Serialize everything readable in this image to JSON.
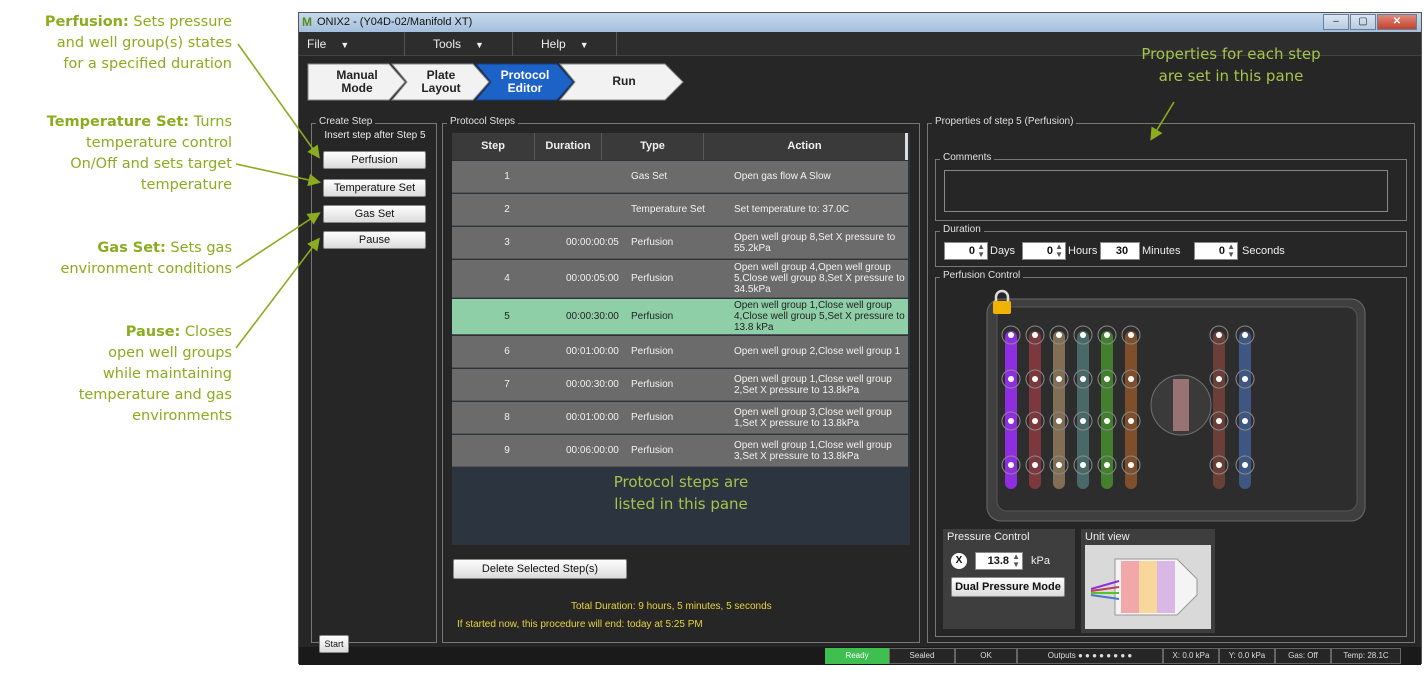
{
  "annotations": {
    "perfusion_title": "Perfusion:",
    "perfusion_l1": " Sets pressure",
    "perfusion_l2": "and well group(s) states",
    "perfusion_l3": "for a specified duration",
    "temp_title": "Temperature Set:",
    "temp_l1": " Turns",
    "temp_l2": "temperature control",
    "temp_l3": "On/Off and sets target",
    "temp_l4": "temperature",
    "gas_title": "Gas Set:",
    "gas_l1": " Sets gas",
    "gas_l2": "environment conditions",
    "pause_title": "Pause:",
    "pause_l1": " Closes",
    "pause_l2": "open well groups",
    "pause_l3": "while maintaining",
    "pause_l4": "temperature and gas",
    "pause_l5": "environments",
    "properties_l1": "Properties for each step",
    "properties_l2": "are set in this pane",
    "steps_l1": "Protocol steps are",
    "steps_l2": "listed in this pane"
  },
  "window": {
    "logo": "M",
    "title": "ONIX2 - (Y04D-02/Manifold XT)",
    "minimize": "–",
    "maximize": "▢",
    "close": "✕"
  },
  "menu": {
    "file": "File",
    "tools": "Tools",
    "help": "Help"
  },
  "breadcrumb": [
    {
      "l1": "Manual",
      "l2": "Mode"
    },
    {
      "l1": "Plate",
      "l2": "Layout"
    },
    {
      "l1": "Protocol",
      "l2": "Editor"
    },
    {
      "l1": "Run",
      "l2": ""
    }
  ],
  "create_step": {
    "label": "Create Step",
    "insert_hint": "Insert step after Step 5",
    "buttons": [
      "Perfusion",
      "Temperature Set",
      "Gas Set",
      "Pause"
    ]
  },
  "protocol": {
    "label": "Protocol Steps",
    "headers": [
      "Step",
      "Duration",
      "Type",
      "Action"
    ],
    "rows": [
      {
        "step": "1",
        "duration": "",
        "type": "Gas Set",
        "action": "Open gas flow A Slow"
      },
      {
        "step": "2",
        "duration": "",
        "type": "Temperature Set",
        "action": "Set temperature to: 37.0C"
      },
      {
        "step": "3",
        "duration": "00:00:00:05",
        "type": "Perfusion",
        "action": "Open well group 8,Set X pressure to 55.2kPa"
      },
      {
        "step": "4",
        "duration": "00:00:05:00",
        "type": "Perfusion",
        "action": "Open well group 4,Open well group 5,Close well group 8,Set X pressure to 34.5kPa"
      },
      {
        "step": "5",
        "duration": "00:00:30:00",
        "type": "Perfusion",
        "action": "Open well group 1,Close well group 4,Close well group 5,Set X pressure to 13.8 kPa"
      },
      {
        "step": "6",
        "duration": "00:01:00:00",
        "type": "Perfusion",
        "action": "Open well group 2,Close well group 1"
      },
      {
        "step": "7",
        "duration": "00:00:30:00",
        "type": "Perfusion",
        "action": "Open well group 1,Close well group 2,Set X pressure to 13.8kPa"
      },
      {
        "step": "8",
        "duration": "00:01:00:00",
        "type": "Perfusion",
        "action": "Open well group 3,Close well group 1,Set X pressure to 13.8kPa"
      },
      {
        "step": "9",
        "duration": "00:06:00:00",
        "type": "Perfusion",
        "action": "Open well group 1,Close well group 3,Set X pressure to 13.8kPa"
      }
    ],
    "selected_step": "5",
    "delete_button": "Delete Selected Step(s)",
    "total_duration": "Total Duration: 9 hours, 5 minutes, 5 seconds",
    "end_estimate": "If started now, this procedure will end: today at 5:25 PM"
  },
  "properties": {
    "label": "Properties of step 5 (Perfusion)",
    "comments_label": "Comments",
    "comments_value": "",
    "duration_label": "Duration",
    "days": "0",
    "days_label": "Days",
    "hours": "0",
    "hours_label": "Hours",
    "minutes": "30",
    "minutes_label": "Minutes",
    "seconds": "0",
    "seconds_label": "Seconds",
    "perfusion_label": "Perfusion Control",
    "pressure_label": "Pressure Control",
    "pressure_channel": "X",
    "pressure_value": "13.8",
    "pressure_unit": "kPa",
    "dual_mode_button": "Dual Pressure Mode",
    "unit_view_label": "Unit view",
    "column_colors": [
      "#8e2ee0",
      "#c0414d",
      "#c9a276",
      "#5f9a98",
      "#55c22e",
      "#c26c2a",
      "#9c4e3f",
      "#4a78c9"
    ]
  },
  "statusbar": {
    "start": "Start",
    "ready": "Ready",
    "sealed": "Sealed",
    "ok": "OK",
    "outputs": "Outputs ● ● ● ● ● ● ● ●",
    "x": "X: 0.0 kPa",
    "y": "Y: 0.0 kPa",
    "gas": "Gas: Off",
    "temp": "Temp: 28.1C"
  }
}
